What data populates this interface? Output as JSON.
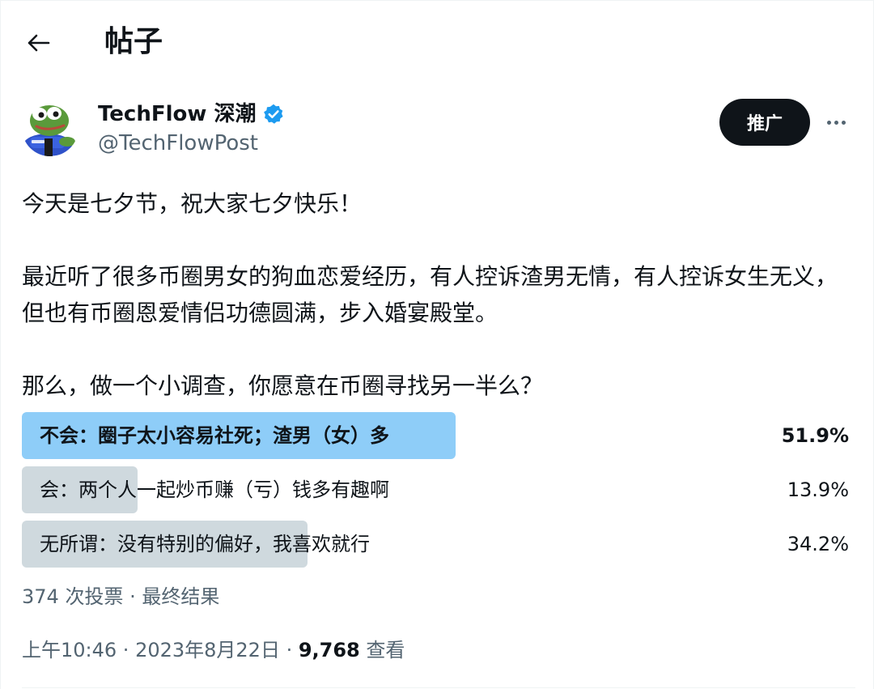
{
  "header": {
    "back_label": "←",
    "title": "帖子"
  },
  "author": {
    "name": "TechFlow 深潮",
    "handle": "@TechFlowPost",
    "verified": true,
    "avatar_icon": "pepe-frog-avatar-icon"
  },
  "actions": {
    "promote_label": "推广",
    "more_icon": "more-horizontal-icon"
  },
  "tweet": {
    "paragraphs": [
      "今天是七夕节，祝大家七夕快乐！",
      "最近听了很多币圈男女的狗血恋爱经历，有人控诉渣男无情，有人控诉女生无义，但也有币圈恩爱情侣功德圆满，步入婚宴殿堂。",
      "那么，做一个小调查，你愿意在币圈寻找另一半么？"
    ]
  },
  "poll": {
    "options": [
      {
        "label": "不会：圈子太小容易社死；渣男（女）多",
        "percent_label": "51.9%",
        "percent": 51.9,
        "winner": true
      },
      {
        "label": "会：两个人一起炒币赚（亏）钱多有趣啊",
        "percent_label": "13.9%",
        "percent": 13.9,
        "winner": false
      },
      {
        "label": "无所谓：没有特别的偏好，我喜欢就行",
        "percent_label": "34.2%",
        "percent": 34.2,
        "winner": false
      }
    ],
    "meta": "374 次投票 · 最终结果"
  },
  "footer": {
    "time": "上午10:46",
    "separator": " · ",
    "date": "2023年8月22日",
    "views_count": "9,768",
    "views_label": " 查看"
  },
  "colors": {
    "winner_bar": "#8ecdf8",
    "other_bar": "#cfd9de",
    "verified": "#1d9bf0",
    "secondary_text": "#536471"
  }
}
